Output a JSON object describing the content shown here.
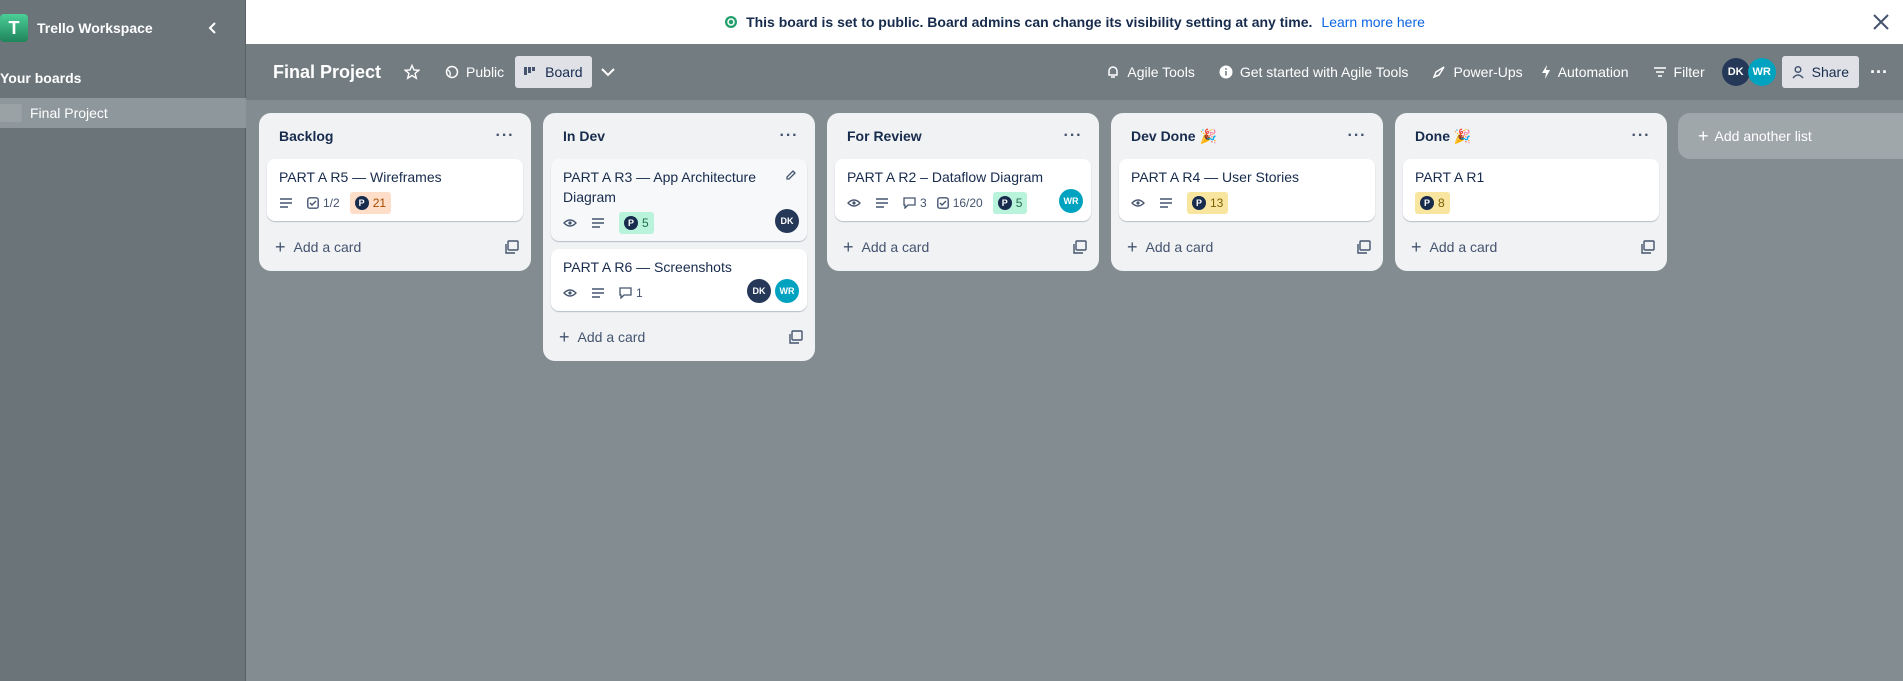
{
  "sidebar": {
    "workspace_logo": "T",
    "workspace_name": "Trello Workspace",
    "your_boards": "Your boards",
    "boards": [
      {
        "label": "Final Project"
      }
    ]
  },
  "banner": {
    "text": "This board is set to public. Board admins can change its visibility setting at any time.",
    "link": "Learn more here"
  },
  "header": {
    "title": "Final Project",
    "visibility": "Public",
    "view": "Board",
    "agile_tools": "Agile Tools",
    "get_started": "Get started with Agile Tools",
    "power_ups": "Power-Ups",
    "automation": "Automation",
    "filter": "Filter",
    "members": [
      "DK",
      "WR"
    ],
    "share": "Share"
  },
  "lists": [
    {
      "title": "Backlog",
      "cards": [
        {
          "title": "PART A R5 — Wireframes",
          "checklist": "1/2",
          "points": "21"
        }
      ],
      "add_card": "Add a card"
    },
    {
      "title": "In Dev",
      "cards": [
        {
          "title": "PART A R3 — App Architecture Diagram",
          "points": "5",
          "members": [
            "DK"
          ]
        },
        {
          "title": "PART A R6 — Screenshots",
          "comments": "1",
          "members": [
            "DK",
            "WR"
          ]
        }
      ],
      "add_card": "Add a card"
    },
    {
      "title": "For Review",
      "cards": [
        {
          "title": "PART A R2 – Dataflow Diagram",
          "comments": "3",
          "checklist": "16/20",
          "points": "5",
          "members": [
            "WR"
          ]
        }
      ],
      "add_card": "Add a card"
    },
    {
      "title": "Dev Done 🎉",
      "cards": [
        {
          "title": "PART A R4 — User Stories",
          "points": "13"
        }
      ],
      "add_card": "Add a card"
    },
    {
      "title": "Done 🎉",
      "cards": [
        {
          "title": "PART A R1",
          "points": "8"
        }
      ],
      "add_card": "Add a card"
    }
  ],
  "add_list": "Add another list",
  "points_badge_letter": "P",
  "colors": {
    "points_orange": "#fedec8",
    "points_green": "#baf3db",
    "points_yellow": "#f8e6a0",
    "avatar_dk": "#253858",
    "avatar_wr": "#00a3bf"
  }
}
